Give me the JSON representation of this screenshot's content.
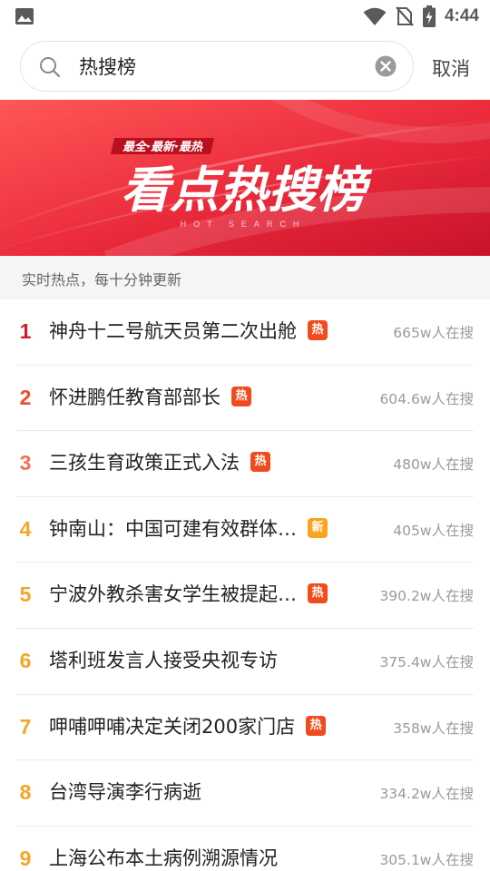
{
  "status_bar": {
    "time": "4:44",
    "icons": [
      "image-icon",
      "wifi-icon",
      "no-sim-icon",
      "battery-charging-icon"
    ]
  },
  "search": {
    "query": "热搜榜",
    "cancel_label": "取消",
    "icons": [
      "search-icon",
      "clear-icon"
    ]
  },
  "banner": {
    "tagline": "最全·最新·最热",
    "title": "看点热搜榜",
    "subtitle": "HOT SEARCH",
    "colors": {
      "from": "#ff4a4a",
      "to": "#d7182e"
    }
  },
  "subheader": "实时热点，每十分钟更新",
  "tag_labels": {
    "hot": "热",
    "new": "新"
  },
  "colors": {
    "rank_1": "#d21e2b",
    "rank_2": "#ef4a2b",
    "rank_3": "#f5704d",
    "rank_rest": "#f5a623",
    "tag_hot": "#f04a1d",
    "tag_new": "#f8a41d"
  },
  "items": [
    {
      "rank": "1",
      "title": "神舟十二号航天员第二次出舱",
      "tag": "热",
      "tag_type": "hot",
      "count": "665w人在搜"
    },
    {
      "rank": "2",
      "title": "怀进鹏任教育部部长",
      "tag": "热",
      "tag_type": "hot",
      "count": "604.6w人在搜"
    },
    {
      "rank": "3",
      "title": "三孩生育政策正式入法",
      "tag": "热",
      "tag_type": "hot",
      "count": "480w人在搜"
    },
    {
      "rank": "4",
      "title": "钟南山：中国可建有效群体…",
      "tag": "新",
      "tag_type": "new",
      "count": "405w人在搜"
    },
    {
      "rank": "5",
      "title": "宁波外教杀害女学生被提起…",
      "tag": "热",
      "tag_type": "hot",
      "count": "390.2w人在搜"
    },
    {
      "rank": "6",
      "title": "塔利班发言人接受央视专访",
      "tag": "",
      "tag_type": "",
      "count": "375.4w人在搜"
    },
    {
      "rank": "7",
      "title": "呷哺呷哺决定关闭200家门店",
      "tag": "热",
      "tag_type": "hot",
      "count": "358w人在搜"
    },
    {
      "rank": "8",
      "title": "台湾导演李行病逝",
      "tag": "",
      "tag_type": "",
      "count": "334.2w人在搜"
    },
    {
      "rank": "9",
      "title": "上海公布本土病例溯源情况",
      "tag": "",
      "tag_type": "",
      "count": "305.1w人在搜"
    }
  ]
}
